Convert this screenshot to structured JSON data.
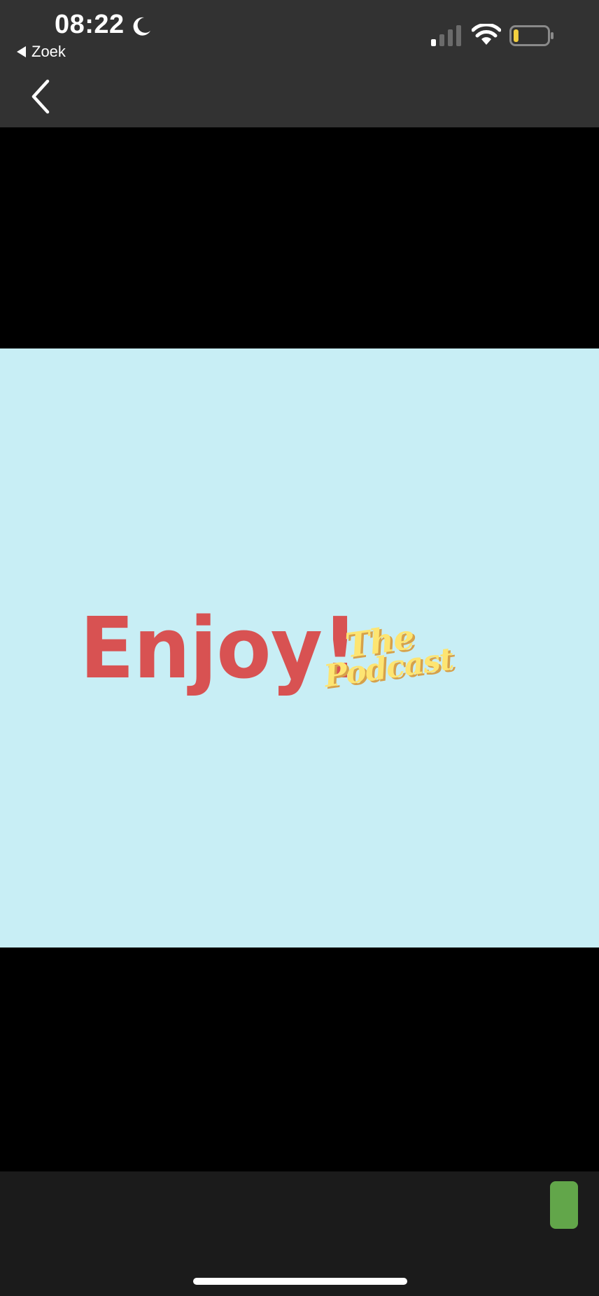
{
  "status_bar": {
    "time": "08:22",
    "back_app_label": "Zoek",
    "icons": [
      "moon-icon",
      "signal-icon",
      "wifi-icon",
      "battery-icon"
    ],
    "battery_level": 0.15,
    "battery_color": "#f4d03f",
    "signal_bars_active": 1,
    "signal_bars_total": 4
  },
  "nav": {
    "back_icon": "chevron-left-icon"
  },
  "artwork": {
    "background_color": "#c8eef5",
    "title_main": "Enjoy!",
    "title_script_line1": "The",
    "title_script_line2": "Podcast",
    "title_main_color": "#d85252",
    "title_script_color": "#fde572"
  },
  "bottom_bar": {
    "accent_button_color": "#62a64a",
    "home_indicator_color": "#ffffff"
  }
}
